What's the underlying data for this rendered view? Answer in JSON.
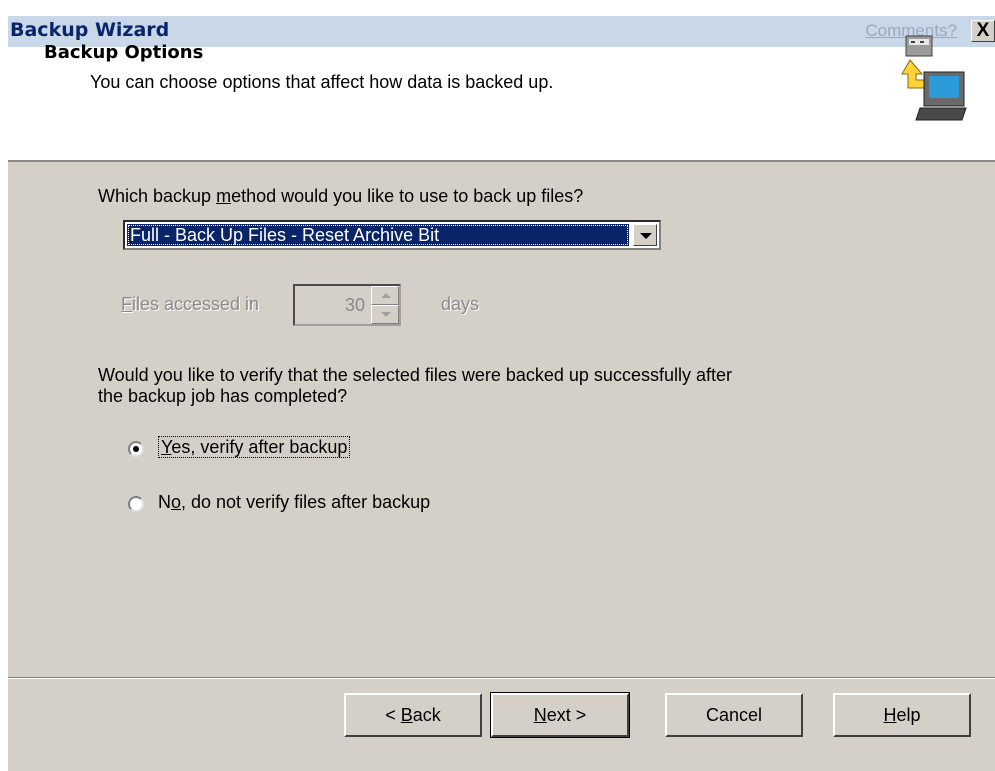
{
  "window": {
    "title": "Backup Wizard",
    "comments_link": "Comments?",
    "close_glyph": "X"
  },
  "header": {
    "title": "Backup Options",
    "subtitle": "You can choose options that affect how data is backed up.",
    "icon": "backup-computer-icon"
  },
  "method": {
    "question_pre": "Which backup ",
    "question_accel": "m",
    "question_post": "ethod would you like to use to back up files?",
    "selected": "Full - Back Up Files - Reset Archive Bit"
  },
  "files_accessed": {
    "label_accel": "F",
    "label_rest": "iles accessed in",
    "value": "30",
    "unit": "days",
    "enabled": false
  },
  "verify": {
    "question_line1": "Would you like to verify that the selected files were backed up successfully after",
    "question_line2": "the backup job has completed?",
    "options": [
      {
        "accel": "Y",
        "rest": "es, verify after backup",
        "checked": true
      },
      {
        "pre": "N",
        "accel": "o",
        "rest": ", do not verify files after backup",
        "checked": false
      }
    ]
  },
  "buttons": {
    "back_pre": "< ",
    "back_accel": "B",
    "back_rest": "ack",
    "next_accel": "N",
    "next_rest": "ext >",
    "cancel": "Cancel",
    "help_accel": "H",
    "help_rest": "elp"
  }
}
